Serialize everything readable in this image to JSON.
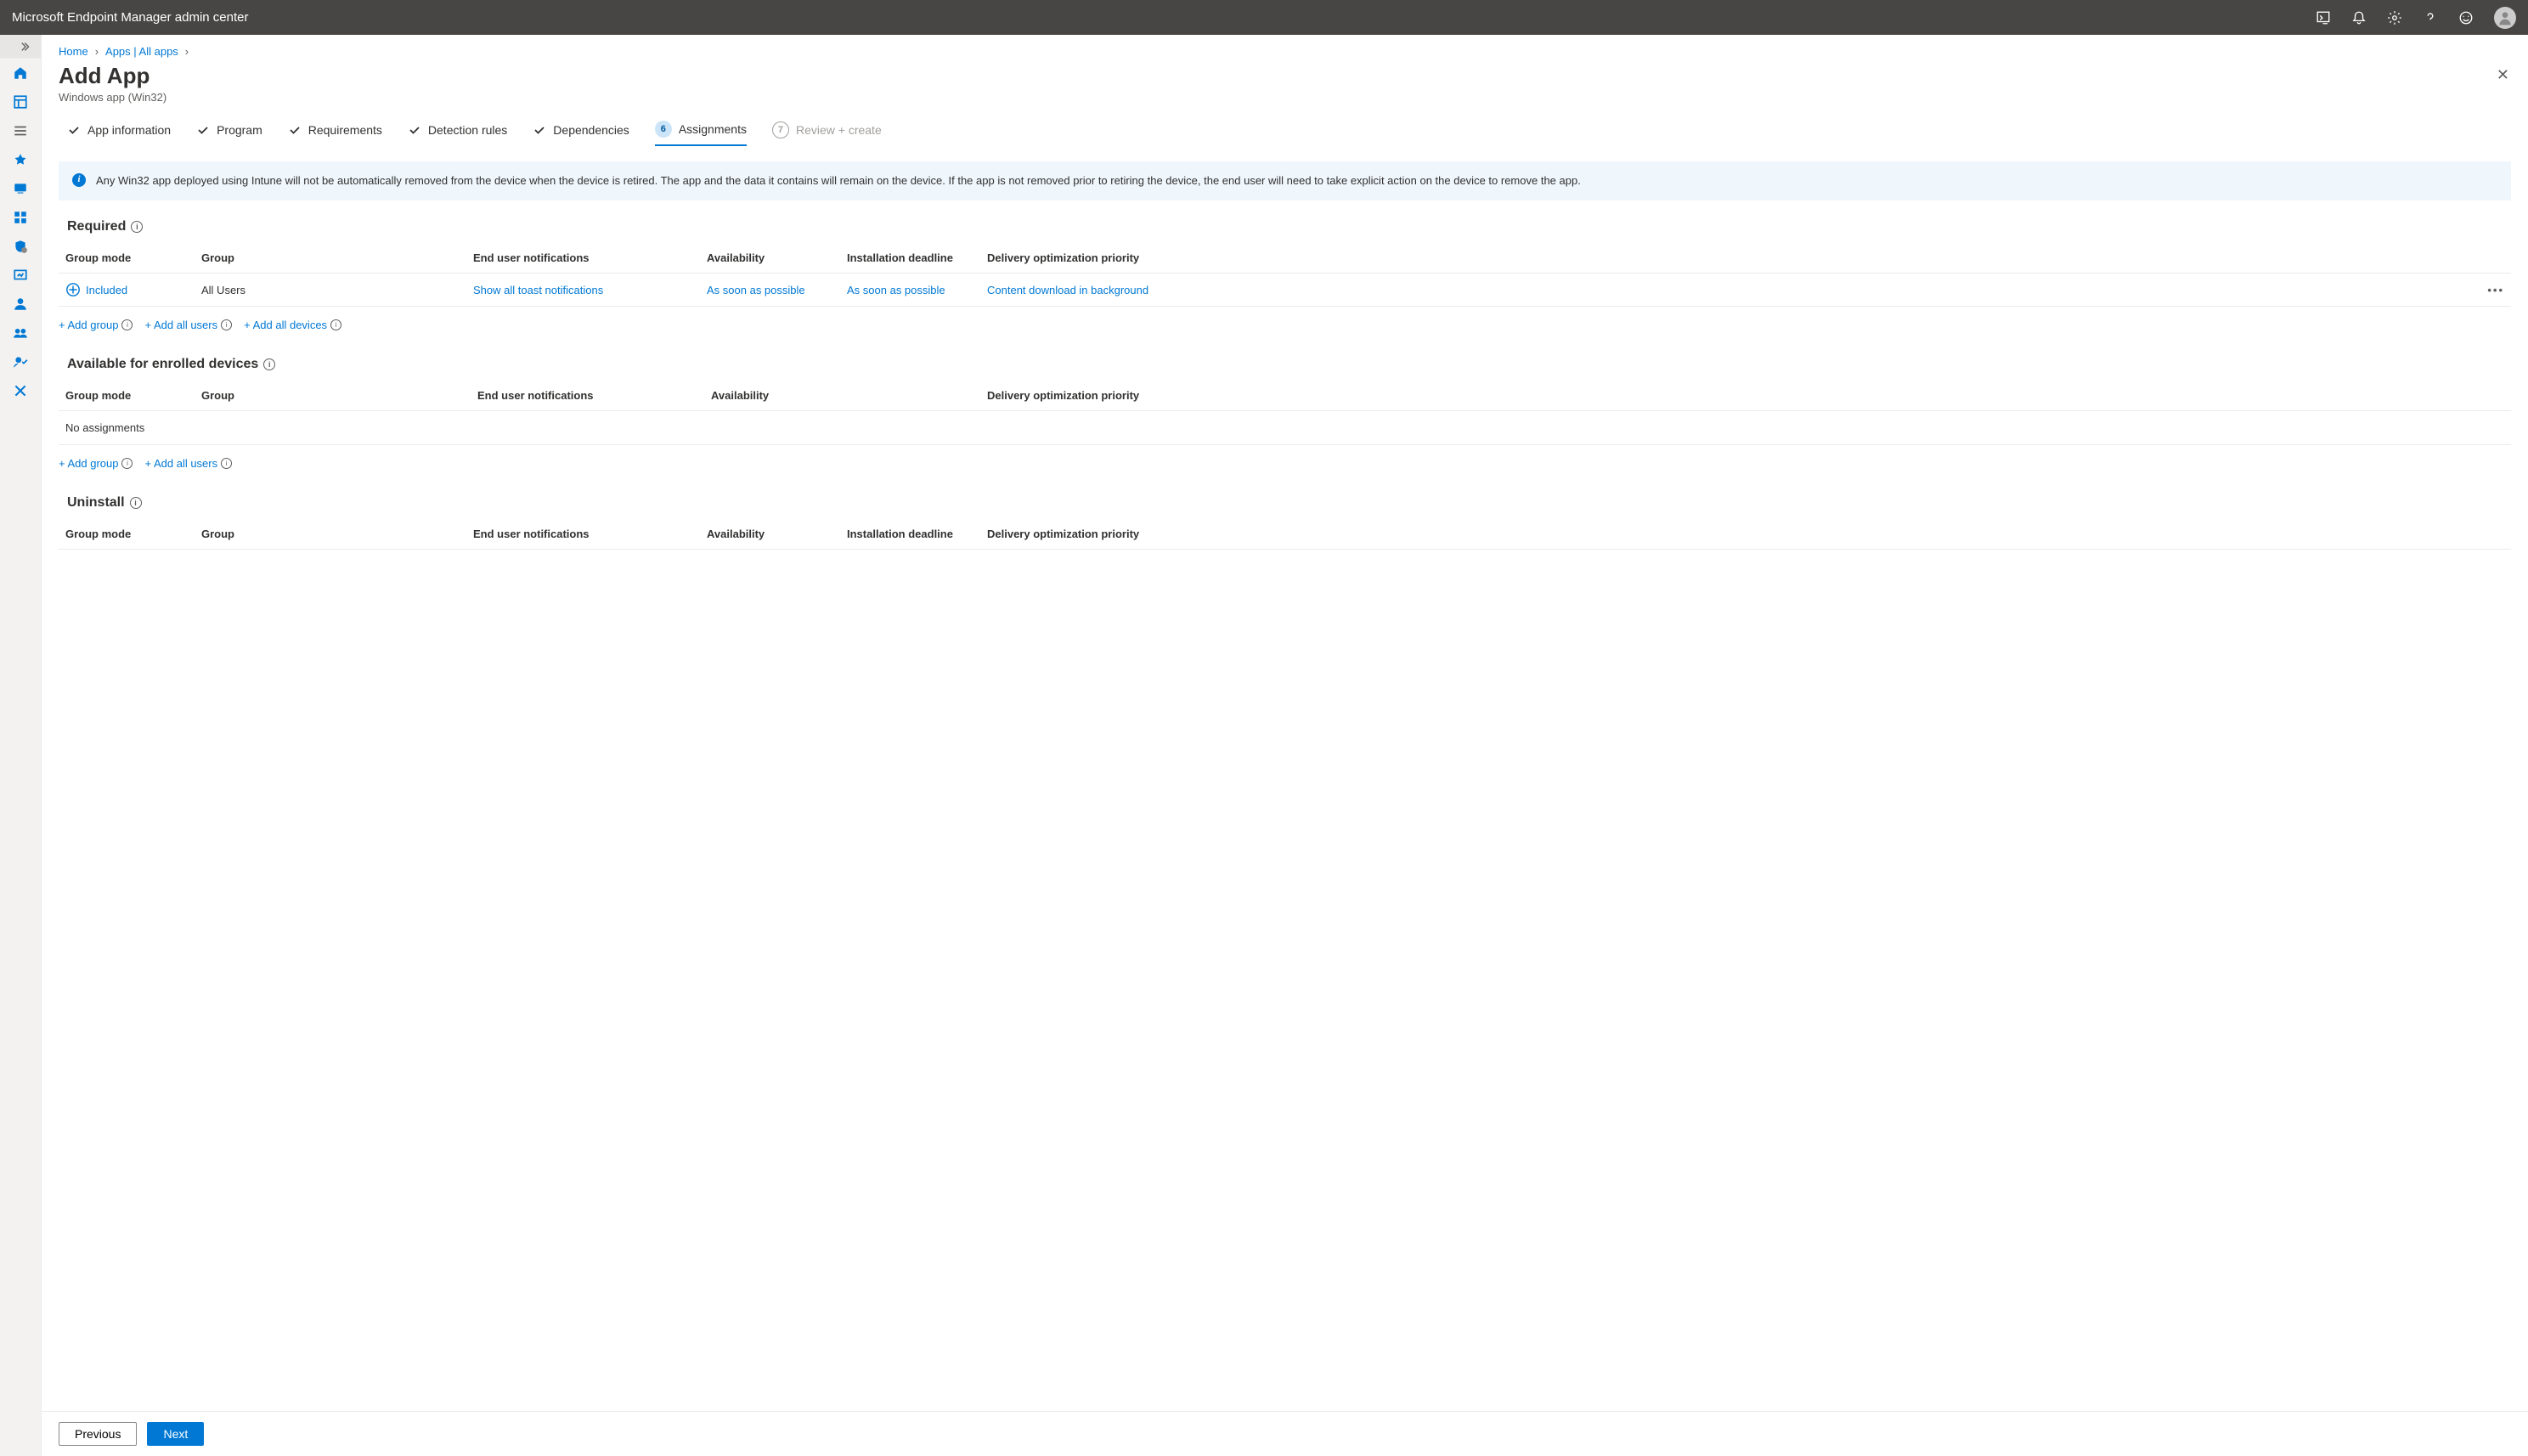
{
  "header": {
    "title": "Microsoft Endpoint Manager admin center"
  },
  "breadcrumb": {
    "home": "Home",
    "apps": "Apps | All apps"
  },
  "page": {
    "title": "Add App",
    "subtitle": "Windows app (Win32)"
  },
  "tabs": {
    "app_info": "App information",
    "program": "Program",
    "requirements": "Requirements",
    "detection": "Detection rules",
    "dependencies": "Dependencies",
    "assignments_step": "6",
    "assignments": "Assignments",
    "review_step": "7",
    "review": "Review + create"
  },
  "info_box": "Any Win32 app deployed using Intune will not be automatically removed from the device when the device is retired. The app and the data it contains will remain on the device. If the app is not removed prior to retiring the device, the end user will need to take explicit action on the device to remove the app.",
  "columns": {
    "mode": "Group mode",
    "group": "Group",
    "notif": "End user notifications",
    "avail": "Availability",
    "deadline": "Installation deadline",
    "deliv": "Delivery optimization priority"
  },
  "sections": {
    "required": {
      "title": "Required",
      "row": {
        "mode": "Included",
        "group": "All Users",
        "notif": "Show all toast notifications",
        "avail": "As soon as possible",
        "deadline": "As soon as possible",
        "deliv": "Content download in background"
      }
    },
    "available": {
      "title": "Available for enrolled devices",
      "empty": "No assignments"
    },
    "uninstall": {
      "title": "Uninstall"
    }
  },
  "add_links": {
    "add_group": "+ Add group",
    "add_all_users": "+ Add all users",
    "add_all_devices": "+ Add all devices"
  },
  "footer": {
    "previous": "Previous",
    "next": "Next"
  }
}
